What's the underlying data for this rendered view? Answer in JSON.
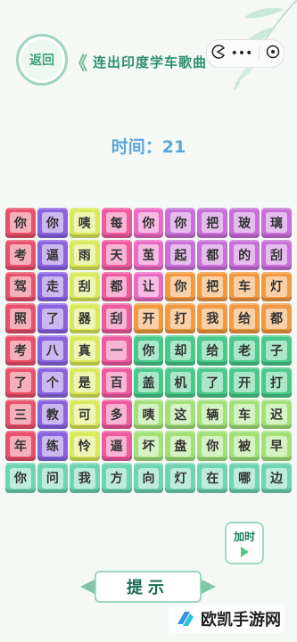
{
  "header": {
    "back_label": "返回",
    "level_title": "连出印度学车歌曲",
    "bracket_left": "《",
    "bracket_right": "》",
    "capsule_icons": [
      "pacman-icon",
      "more-icon",
      "close-icon"
    ]
  },
  "timer": {
    "text": "时间：21"
  },
  "board": {
    "rows": [
      [
        {
          "ch": "你",
          "color": "#e8506b"
        },
        {
          "ch": "你",
          "color": "#8a63e0"
        },
        {
          "ch": "咦",
          "color": "#d8ea5a"
        },
        {
          "ch": "每",
          "color": "#ee5a9f"
        },
        {
          "ch": "你",
          "color": "#ea6cc2"
        },
        {
          "ch": "你",
          "color": "#c86fd8"
        },
        {
          "ch": "把",
          "color": "#c86fd8"
        },
        {
          "ch": "玻",
          "color": "#c86fd8"
        },
        {
          "ch": "璃",
          "color": "#c86fd8"
        }
      ],
      [
        {
          "ch": "考",
          "color": "#e8506b"
        },
        {
          "ch": "逼",
          "color": "#8a63e0"
        },
        {
          "ch": "雨",
          "color": "#d8ea5a"
        },
        {
          "ch": "天",
          "color": "#ee5a9f"
        },
        {
          "ch": "茧",
          "color": "#ea6cc2"
        },
        {
          "ch": "起",
          "color": "#c86fd8"
        },
        {
          "ch": "都",
          "color": "#c86fd8"
        },
        {
          "ch": "的",
          "color": "#c86fd8"
        },
        {
          "ch": "刮",
          "color": "#c86fd8"
        }
      ],
      [
        {
          "ch": "驾",
          "color": "#e8506b"
        },
        {
          "ch": "走",
          "color": "#8a63e0"
        },
        {
          "ch": "刮",
          "color": "#d8ea5a"
        },
        {
          "ch": "都",
          "color": "#ee5a9f"
        },
        {
          "ch": "让",
          "color": "#ea6cc2"
        },
        {
          "ch": "你",
          "color": "#f29a42"
        },
        {
          "ch": "把",
          "color": "#f29a42"
        },
        {
          "ch": "车",
          "color": "#f29a42"
        },
        {
          "ch": "灯",
          "color": "#f29a42"
        }
      ],
      [
        {
          "ch": "照",
          "color": "#e8506b"
        },
        {
          "ch": "了",
          "color": "#8a63e0"
        },
        {
          "ch": "器",
          "color": "#d8ea5a"
        },
        {
          "ch": "刮",
          "color": "#ee5a9f"
        },
        {
          "ch": "开",
          "color": "#f29a42"
        },
        {
          "ch": "打",
          "color": "#f29a42"
        },
        {
          "ch": "我",
          "color": "#f29a42"
        },
        {
          "ch": "给",
          "color": "#f29a42"
        },
        {
          "ch": "都",
          "color": "#f29a42"
        }
      ],
      [
        {
          "ch": "考",
          "color": "#e8506b"
        },
        {
          "ch": "八",
          "color": "#8a63e0"
        },
        {
          "ch": "真",
          "color": "#d8ea5a"
        },
        {
          "ch": "一",
          "color": "#ee5a9f"
        },
        {
          "ch": "你",
          "color": "#49c98a"
        },
        {
          "ch": "却",
          "color": "#49c98a"
        },
        {
          "ch": "给",
          "color": "#49c98a"
        },
        {
          "ch": "老",
          "color": "#49c98a"
        },
        {
          "ch": "子",
          "color": "#49c98a"
        }
      ],
      [
        {
          "ch": "了",
          "color": "#e8506b"
        },
        {
          "ch": "个",
          "color": "#8a63e0"
        },
        {
          "ch": "是",
          "color": "#d8ea5a"
        },
        {
          "ch": "百",
          "color": "#ee5a9f"
        },
        {
          "ch": "盖",
          "color": "#49c98a"
        },
        {
          "ch": "机",
          "color": "#49c98a"
        },
        {
          "ch": "了",
          "color": "#49c98a"
        },
        {
          "ch": "开",
          "color": "#49c98a"
        },
        {
          "ch": "打",
          "color": "#49c98a"
        }
      ],
      [
        {
          "ch": "三",
          "color": "#e8506b"
        },
        {
          "ch": "教",
          "color": "#8a63e0"
        },
        {
          "ch": "可",
          "color": "#d8ea5a"
        },
        {
          "ch": "多",
          "color": "#ee5a9f"
        },
        {
          "ch": "咦",
          "color": "#a4e07a"
        },
        {
          "ch": "这",
          "color": "#a4e07a"
        },
        {
          "ch": "辆",
          "color": "#a4e07a"
        },
        {
          "ch": "车",
          "color": "#a4e07a"
        },
        {
          "ch": "迟",
          "color": "#a4e07a"
        }
      ],
      [
        {
          "ch": "年",
          "color": "#e8506b"
        },
        {
          "ch": "练",
          "color": "#8a63e0"
        },
        {
          "ch": "怜",
          "color": "#d8ea5a"
        },
        {
          "ch": "逼",
          "color": "#ee5a9f"
        },
        {
          "ch": "坏",
          "color": "#a4e07a"
        },
        {
          "ch": "盘",
          "color": "#a4e07a"
        },
        {
          "ch": "你",
          "color": "#a4e07a"
        },
        {
          "ch": "被",
          "color": "#a4e07a"
        },
        {
          "ch": "早",
          "color": "#a4e07a"
        }
      ],
      [
        {
          "ch": "你",
          "color": "#6fd4b2"
        },
        {
          "ch": "问",
          "color": "#6fd4b2"
        },
        {
          "ch": "我",
          "color": "#6fd4b2"
        },
        {
          "ch": "方",
          "color": "#6fd4b2"
        },
        {
          "ch": "向",
          "color": "#6fd4b2"
        },
        {
          "ch": "灯",
          "color": "#6fd4b2"
        },
        {
          "ch": "在",
          "color": "#6fd4b2"
        },
        {
          "ch": "哪",
          "color": "#6fd4b2"
        },
        {
          "ch": "边",
          "color": "#6fd4b2"
        }
      ]
    ]
  },
  "add_time": {
    "label": "加时"
  },
  "hint": {
    "label": "提示"
  },
  "watermark": {
    "text": "欧凯手游网"
  }
}
